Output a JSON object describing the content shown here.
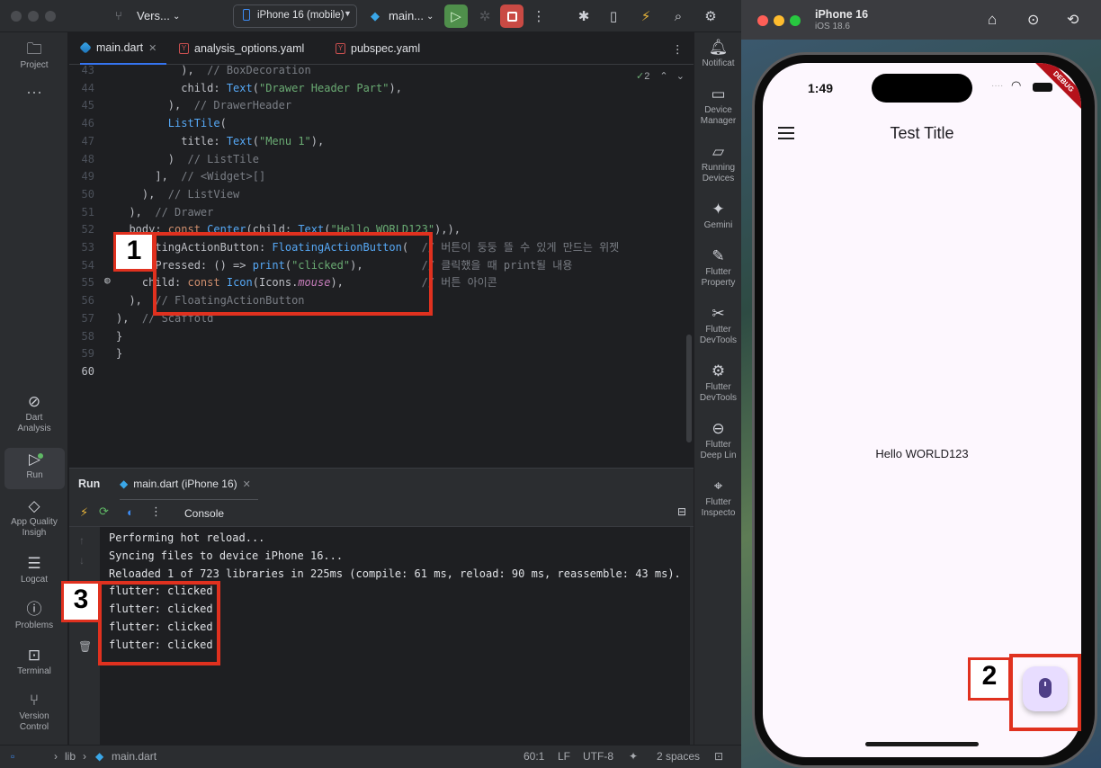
{
  "ide": {
    "titlebar": {
      "project_name": "Vers...",
      "device_selector": "iPhone 16 (mobile)",
      "run_config": "main..."
    },
    "left_tools": [
      {
        "label": "Project",
        "icon": "folder-icon"
      },
      {
        "label": "Dart Analysis",
        "icon": "dart-analysis-icon"
      },
      {
        "label": "Run",
        "icon": "run-icon"
      },
      {
        "label": "App Quality Insigh",
        "icon": "diamond-icon"
      },
      {
        "label": "Logcat",
        "icon": "logcat-icon"
      },
      {
        "label": "Problems",
        "icon": "problems-icon"
      },
      {
        "label": "Terminal",
        "icon": "terminal-icon"
      },
      {
        "label": "Version Control",
        "icon": "git-icon"
      }
    ],
    "right_tools": [
      {
        "label": "Notificat",
        "icon": "bell-icon"
      },
      {
        "label": "Device Manager",
        "icon": "device-manager-icon"
      },
      {
        "label": "Running Devices",
        "icon": "running-devices-icon"
      },
      {
        "label": "Gemini",
        "icon": "sparkle-icon"
      },
      {
        "label": "Flutter Property",
        "icon": "flutter-property-icon"
      },
      {
        "label": "Flutter DevTools",
        "icon": "devtools-icon"
      },
      {
        "label": "Flutter DevTools",
        "icon": "devtools-icon"
      },
      {
        "label": "Flutter Deep Lin",
        "icon": "link-icon"
      },
      {
        "label": "Flutter Inspecto",
        "icon": "inspector-icon"
      }
    ],
    "tabs": [
      {
        "label": "main.dart",
        "active": true
      },
      {
        "label": "analysis_options.yaml",
        "active": false
      },
      {
        "label": "pubspec.yaml",
        "active": false
      }
    ],
    "inspection_count": "2",
    "code_lines": [
      {
        "n": "43",
        "text": "          ),  // BoxDecoration"
      },
      {
        "n": "44",
        "text": "          child: Text(\"Drawer Header Part\"),"
      },
      {
        "n": "45",
        "text": "        ),  // DrawerHeader"
      },
      {
        "n": "46",
        "text": "        ListTile("
      },
      {
        "n": "47",
        "text": "          title: Text(\"Menu 1\"),"
      },
      {
        "n": "48",
        "text": "        )  // ListTile"
      },
      {
        "n": "49",
        "text": "      ],  // <Widget>[]"
      },
      {
        "n": "50",
        "text": "    ),  // ListView"
      },
      {
        "n": "51",
        "text": "  ),  // Drawer"
      },
      {
        "n": "52",
        "text": "  body: const Center(child: Text(\"Hello WORLD123\"),),"
      },
      {
        "n": "53",
        "text": "  floatingActionButton: FloatingActionButton(  // 버튼이 둥둥 뜰 수 있게 만드는 위젯"
      },
      {
        "n": "54",
        "text": "    onPressed: () => print(\"clicked\"),         // 클릭했을 때 print될 내용"
      },
      {
        "n": "55",
        "text": "    child: const Icon(Icons.mouse),            // 버튼 아이콘"
      },
      {
        "n": "56",
        "text": "  ),  // FloatingActionButton"
      },
      {
        "n": "57",
        "text": "),  // Scaffold"
      },
      {
        "n": "58",
        "text": "}"
      },
      {
        "n": "59",
        "text": "}"
      },
      {
        "n": "60",
        "text": ""
      }
    ],
    "run_panel": {
      "title": "Run",
      "run_tab": "main.dart (iPhone 16)",
      "console_label": "Console",
      "lines": [
        "Performing hot reload...",
        "Syncing files to device iPhone 16...",
        "Reloaded 1 of 723 libraries in 225ms (compile: 61 ms, reload: 90 ms, reassemble: 43 ms).",
        "flutter: clicked",
        "flutter: clicked",
        "flutter: clicked",
        "flutter: clicked"
      ]
    },
    "statusbar": {
      "path_lib": "lib",
      "path_file": "main.dart",
      "position": "60:1",
      "line_ending": "LF",
      "encoding": "UTF-8",
      "indent": "2 spaces"
    }
  },
  "simulator": {
    "device_name": "iPhone 16",
    "os_version": "iOS 18.6",
    "time": "1:49",
    "debug_banner": "DEBUG",
    "app_title": "Test Title",
    "body_text": "Hello WORLD123"
  },
  "annotations": [
    "1",
    "2",
    "3"
  ],
  "colors": {
    "annotation_red": "#e0311f",
    "ide_bg": "#1e1f22",
    "fab_bg": "#e8ddff",
    "accent_blue": "#3574f0"
  }
}
